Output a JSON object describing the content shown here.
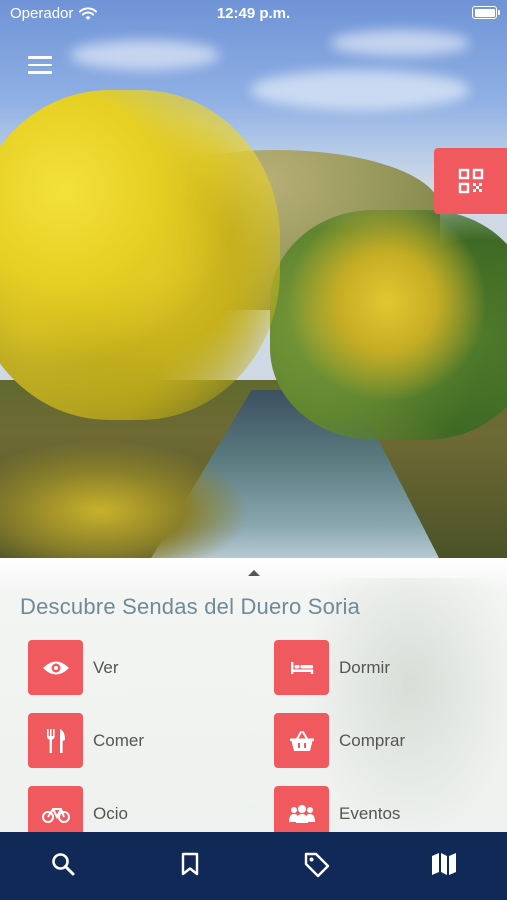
{
  "status_bar": {
    "carrier": "Operador",
    "time": "12:49 p.m."
  },
  "icons": {
    "menu": "hamburger-menu-icon",
    "qr": "qr-code-icon",
    "wifi": "wifi-icon",
    "battery": "battery-icon"
  },
  "panel": {
    "title": "Descubre Sendas del Duero Soria",
    "categories": [
      {
        "label": "Ver",
        "icon": "eye-icon"
      },
      {
        "label": "Dormir",
        "icon": "bed-icon"
      },
      {
        "label": "Comer",
        "icon": "fork-knife-icon"
      },
      {
        "label": "Comprar",
        "icon": "basket-icon"
      },
      {
        "label": "Ocio",
        "icon": "bicycle-icon"
      },
      {
        "label": "Eventos",
        "icon": "people-icon"
      }
    ]
  },
  "tabbar": [
    {
      "icon": "search-icon"
    },
    {
      "icon": "bookmark-icon"
    },
    {
      "icon": "tag-icon"
    },
    {
      "icon": "map-icon"
    }
  ],
  "colors": {
    "accent": "#f0595e",
    "tabbar": "#112957",
    "title": "#6f8a98"
  }
}
